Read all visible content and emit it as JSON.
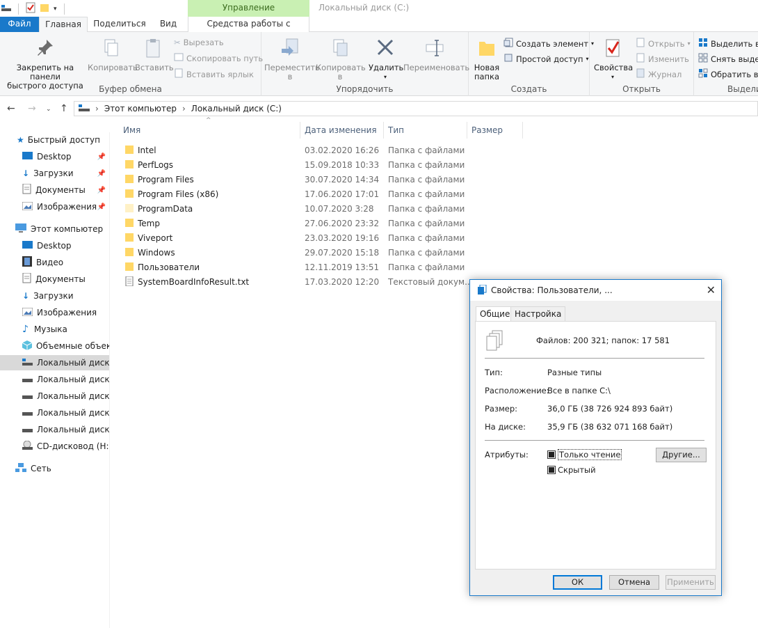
{
  "titlebar": {
    "context_group": "Управление",
    "window_title": "Локальный диск (C:)"
  },
  "tabs": {
    "file": "Файл",
    "home": "Главная",
    "share": "Поделиться",
    "view": "Вид",
    "disk_tools": "Средства работы с дисками"
  },
  "ribbon": {
    "clipboard": {
      "label": "Буфер обмена",
      "pin_line1": "Закрепить на панели",
      "pin_line2": "быстрого доступа",
      "copy": "Копировать",
      "paste": "Вставить",
      "cut": "Вырезать",
      "copy_path": "Скопировать путь",
      "paste_shortcut": "Вставить ярлык"
    },
    "organize": {
      "label": "Упорядочить",
      "move_line1": "Переместить",
      "move_line2": "в",
      "copy_to_line1": "Копировать",
      "copy_to_line2": "в",
      "delete": "Удалить",
      "rename": "Переименовать"
    },
    "create": {
      "label": "Создать",
      "new_folder_line1": "Новая",
      "new_folder_line2": "папка",
      "new_item": "Создать элемент",
      "easy_access": "Простой доступ"
    },
    "open": {
      "label": "Открыть",
      "properties": "Свойства",
      "open": "Открыть",
      "edit": "Изменить",
      "history": "Журнал"
    },
    "select": {
      "label": "Выдели",
      "select_all": "Выделить вс",
      "select_none": "Снять выдел",
      "invert": "Обратить вы"
    }
  },
  "address": {
    "path1": "Этот компьютер",
    "path2": "Локальный диск (C:)"
  },
  "sidebar": {
    "quick_access": "Быстрый доступ",
    "qa_desktop": "Desktop",
    "qa_downloads": "Загрузки",
    "qa_documents": "Документы",
    "qa_pictures": "Изображения",
    "this_pc": "Этот компьютер",
    "pc_desktop": "Desktop",
    "pc_video": "Видео",
    "pc_documents": "Документы",
    "pc_downloads": "Загрузки",
    "pc_pictures": "Изображения",
    "pc_music": "Музыка",
    "pc_3d": "Объемные объекты",
    "disk_c": "Локальный диск (C",
    "disk_d": "Локальный диск (D",
    "disk_e": "Локальный диск (E",
    "disk_f": "Локальный диск (F",
    "disk_g": "Локальный диск (G",
    "cd": "CD-дисковод (H:) V",
    "network": "Сеть"
  },
  "columns": {
    "name": "Имя",
    "date": "Дата изменения",
    "type": "Тип",
    "size": "Размер"
  },
  "files": [
    {
      "name": "Intel",
      "date": "03.02.2020 16:26",
      "type": "Папка с файлами"
    },
    {
      "name": "PerfLogs",
      "date": "15.09.2018 10:33",
      "type": "Папка с файлами"
    },
    {
      "name": "Program Files",
      "date": "30.07.2020 14:34",
      "type": "Папка с файлами"
    },
    {
      "name": "Program Files (x86)",
      "date": "17.06.2020 17:01",
      "type": "Папка с файлами"
    },
    {
      "name": "ProgramData",
      "date": "10.07.2020 3:28",
      "type": "Папка с файлами"
    },
    {
      "name": "Temp",
      "date": "27.06.2020 23:32",
      "type": "Папка с файлами"
    },
    {
      "name": "Viveport",
      "date": "23.03.2020 19:16",
      "type": "Папка с файлами"
    },
    {
      "name": "Windows",
      "date": "29.07.2020 15:18",
      "type": "Папка с файлами"
    },
    {
      "name": "Пользователи",
      "date": "12.11.2019 13:51",
      "type": "Папка с файлами"
    },
    {
      "name": "SystemBoardInfoResult.txt",
      "date": "17.03.2020 12:20",
      "type": "Текстовый докум..."
    }
  ],
  "dialog": {
    "title": "Свойства: Пользователи, ...",
    "tab_general": "Общие",
    "tab_settings": "Настройка",
    "summary": "Файлов: 200 321; папок: 17 581",
    "type_label": "Тип:",
    "type_value": "Разные типы",
    "location_label": "Расположение:",
    "location_value": "Все в папке C:\\",
    "size_label": "Размер:",
    "size_value": "36,0 ГБ (38 726 924 893 байт)",
    "disk_label": "На диске:",
    "disk_value": "35,9 ГБ (38 632 071 168 байт)",
    "attributes_label": "Атрибуты:",
    "readonly": "Только чтение",
    "hidden": "Скрытый",
    "other": "Другие...",
    "ok": "ОК",
    "cancel": "Отмена",
    "apply": "Применить"
  },
  "colors": {
    "accent": "#1979ca",
    "context_green": "#c9f0b3",
    "folder": "#ffd766",
    "selection": "#d9d9d9"
  }
}
